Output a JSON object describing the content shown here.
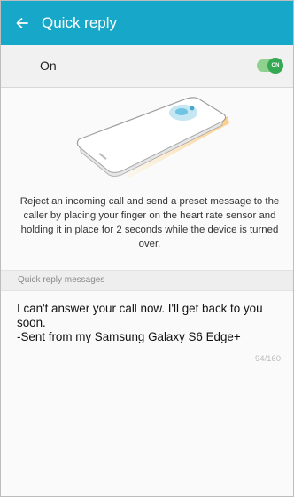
{
  "appbar": {
    "title": "Quick reply",
    "back_icon": "arrow-left-icon",
    "color": "#17a8c9"
  },
  "toggle_row": {
    "label": "On",
    "switch_state": "ON",
    "accent": "#34a853"
  },
  "illustration": {
    "icon": "phone-heart-rate-sensor-illustration"
  },
  "description": "Reject an incoming call and send a preset message to the caller by placing your finger on the heart rate sensor and holding it in place for 2 seconds while the device is turned over.",
  "section": {
    "header": "Quick reply messages"
  },
  "message": {
    "text": "I can't answer your call now. I'll get back to you soon.\n-Sent from my Samsung Galaxy S6 Edge+",
    "counter": "94/160"
  }
}
